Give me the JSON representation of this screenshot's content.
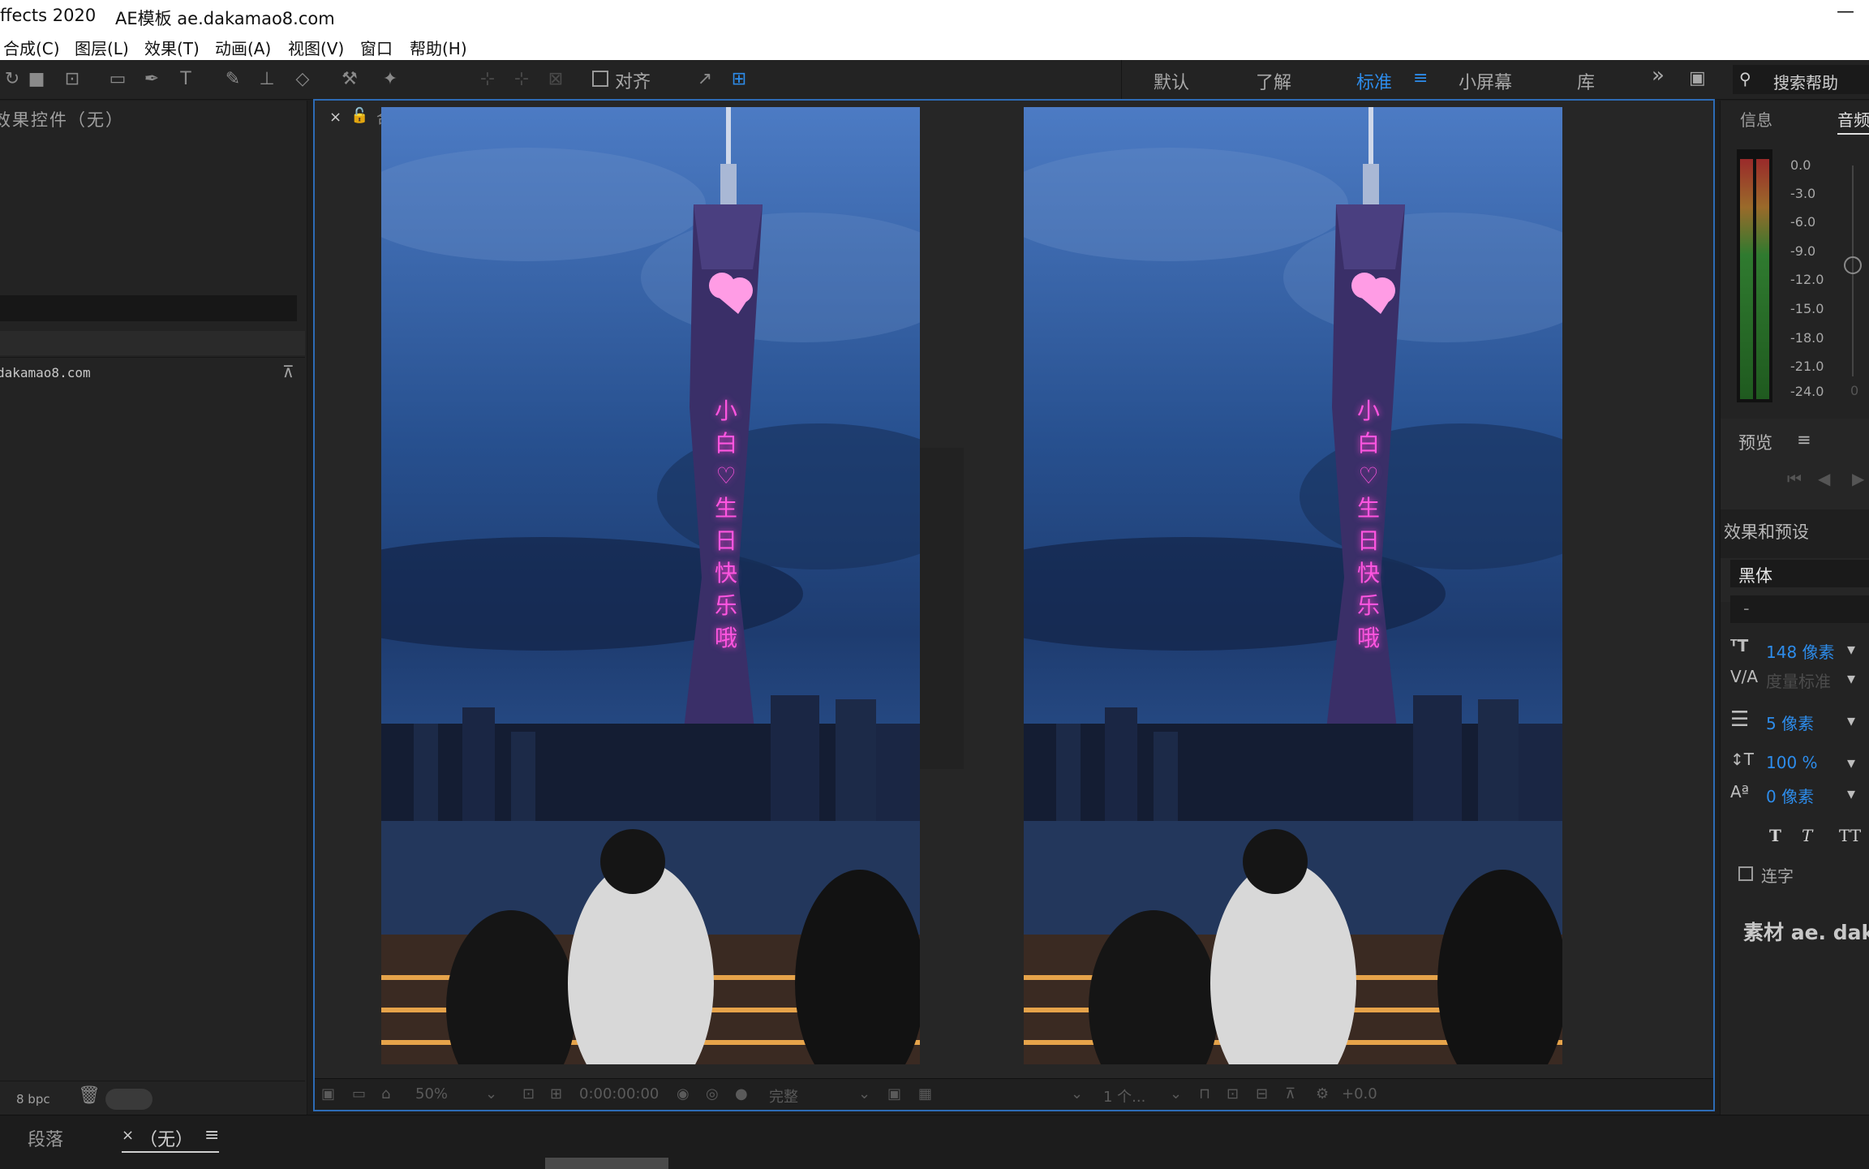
{
  "window": {
    "app_title": "ffects 2020",
    "template_title": "AE模板 ae.dakamao8.com",
    "minimize": "—"
  },
  "menu": [
    {
      "label": "合成(C)"
    },
    {
      "label": "图层(L)"
    },
    {
      "label": "效果(T)"
    },
    {
      "label": "动画(A)"
    },
    {
      "label": "视图(V)"
    },
    {
      "label": "窗口"
    },
    {
      "label": "帮助(H)"
    }
  ],
  "toolbar": {
    "align_label": "对齐",
    "workspaces": [
      "默认",
      "了解",
      "标准",
      "小屏幕",
      "库"
    ],
    "active_workspace": "标准",
    "more": "»",
    "search_help": "搜索帮助"
  },
  "left_panel": {
    "title": "效果控件（无）",
    "project_item": "dakamao8.com",
    "bpc": "8 bpc"
  },
  "viewer": {
    "close": "×",
    "tab_initial": "合",
    "zoom": "50%",
    "timecode": "0:00:00:00",
    "resolution": "完整",
    "views": "1 个...",
    "exposure": "+0.0",
    "tower_text": [
      "小",
      "白",
      "♡",
      "生",
      "日",
      "快",
      "乐",
      "哦"
    ]
  },
  "right_panel": {
    "info_tab": "信息",
    "audio_tab": "音频",
    "meter_labels": [
      "0.0",
      "-3.0",
      "-6.0",
      "-9.0",
      "-12.0",
      "-15.0",
      "-18.0",
      "-21.0",
      "-24.0"
    ],
    "meter_zero": "0",
    "preview_label": "预览",
    "effects_presets_label": "效果和预设",
    "font_family": "黑体",
    "font_style": "-",
    "font_size": "148 像素",
    "tracking": "度量标准",
    "stroke_width": "5 像素",
    "vertical_scale": "100 %",
    "baseline_shift": "0 像素",
    "ligature_label": "连字",
    "watermark": "素材 ae. dak"
  },
  "bottom": {
    "paragraph_tab": "段落",
    "close": "×",
    "none_tab": "（无）",
    "menu_icon": "≡"
  },
  "colors": {
    "accent": "#2d8ceb",
    "panel_bg": "#232323",
    "sky": "#2f5d9c",
    "neon": "#ff55e0"
  }
}
